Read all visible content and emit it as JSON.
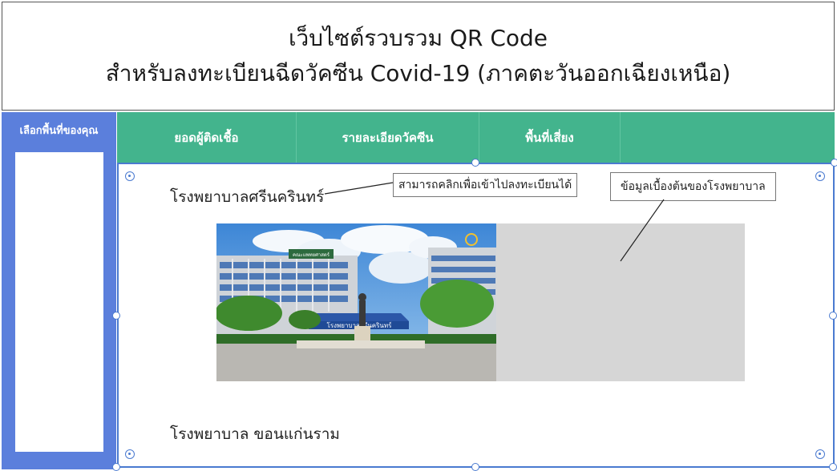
{
  "header": {
    "title_line1": "เว็บไซต์รวบรวม QR Code",
    "title_line2": "สำหรับลงทะเบียนฉีดวัคซีน Covid-19 (ภาคตะวันออกเฉียงเหนือ)"
  },
  "sidebar": {
    "label": "เลือกพื้นที่ของคุณ"
  },
  "nav": {
    "items": [
      {
        "label": "ยอดผู้ติดเชื้อ"
      },
      {
        "label": "รายละเอียดวัคซีน"
      },
      {
        "label": "พื้นที่เสี่ยง"
      },
      {
        "label": ""
      }
    ]
  },
  "content": {
    "hospital1": "โรงพยาบาลศรีนครินทร์",
    "hospital2": "โรงพยาบาล ขอนแก่นราม",
    "callout_register": "สามารถคลิกเพื่อเข้าไปลงทะเบียนได้",
    "callout_info": "ข้อมูลเบื้องต้นของโรงพยาบาล",
    "photo_sign": "โรงพยาบาลศรีนครินทร์"
  },
  "colors": {
    "sidebar": "#5b7fdc",
    "navbar": "#43b48d",
    "selection": "#4a7ad0",
    "info_panel": "#d6d6d6"
  }
}
